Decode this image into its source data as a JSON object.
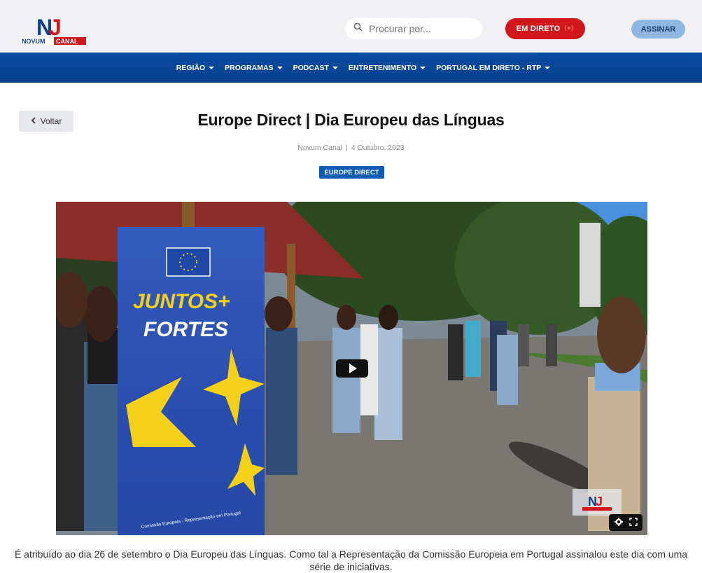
{
  "header": {
    "logo_alt": "NOVUM CANAL",
    "logo_text_top": "NOVUM",
    "logo_text_bottom": "CANAL",
    "search_placeholder": "Procurar por...",
    "live_label": "EM DIRETO",
    "subscribe_label": "ASSINAR",
    "brand_color": "#0a4ea5",
    "live_color": "#d1171b"
  },
  "nav": {
    "items": [
      {
        "label": "REGIÃO"
      },
      {
        "label": "PROGRAMAS"
      },
      {
        "label": "PODCAST"
      },
      {
        "label": "ENTRETENIMENTO"
      },
      {
        "label": "PORTUGAL EM DIRETO - RTP"
      }
    ]
  },
  "article": {
    "back_label": "Voltar",
    "title": "Europe Direct | Dia Europeu das Línguas",
    "author": "Novum Canal",
    "separator": "|",
    "date": "4 Outubro, 2023",
    "tag": "EUROPE DIRECT",
    "video": {
      "banner_line1": "JUNTOS+",
      "banner_line2": "FORTES",
      "banner_footer": "Comissão Europeia - Representação em Portugal"
    },
    "caption": "É atribuído ao dia 26 de setembro o Dia Europeu das Línguas. Como tal a Representação da Comissão Europeia em Portugal assinalou este dia com uma série de iniciativas."
  },
  "icons": [
    "search-icon",
    "live-dot-icon",
    "chevron-left-icon",
    "play-icon",
    "gear-icon",
    "fullscreen-icon",
    "caret-down-icon"
  ]
}
